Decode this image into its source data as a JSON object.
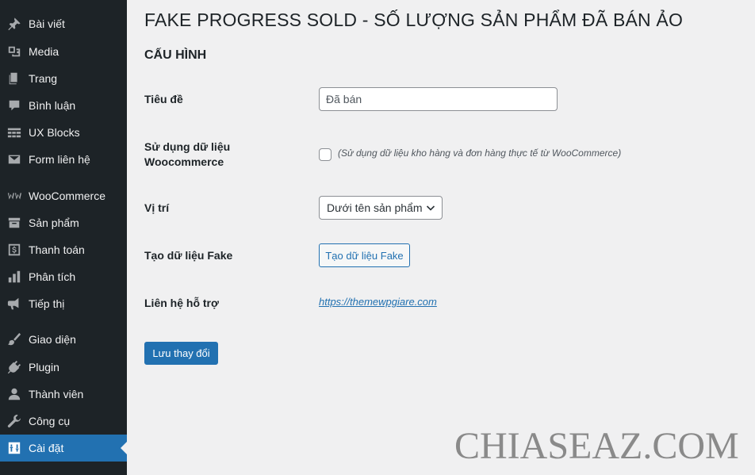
{
  "sidebar": {
    "items": [
      {
        "label": "Bài viết",
        "icon": "pin-icon"
      },
      {
        "label": "Media",
        "icon": "media-icon"
      },
      {
        "label": "Trang",
        "icon": "page-icon"
      },
      {
        "label": "Bình luận",
        "icon": "comment-icon"
      },
      {
        "label": "UX Blocks",
        "icon": "blocks-icon"
      },
      {
        "label": "Form liên hệ",
        "icon": "mail-icon"
      },
      {
        "label": "WooCommerce",
        "icon": "woocommerce-icon"
      },
      {
        "label": "Sản phẩm",
        "icon": "archive-icon"
      },
      {
        "label": "Thanh toán",
        "icon": "dollar-icon"
      },
      {
        "label": "Phân tích",
        "icon": "bar-chart-icon"
      },
      {
        "label": "Tiếp thị",
        "icon": "megaphone-icon"
      },
      {
        "label": "Giao diện",
        "icon": "brush-icon"
      },
      {
        "label": "Plugin",
        "icon": "plug-icon"
      },
      {
        "label": "Thành viên",
        "icon": "user-icon"
      },
      {
        "label": "Công cụ",
        "icon": "wrench-icon"
      },
      {
        "label": "Cài đặt",
        "icon": "settings-icon",
        "active": true
      }
    ]
  },
  "main": {
    "page_title": "FAKE PROGRESS SOLD - SỐ LƯỢNG SẢN PHẨM ĐÃ BÁN ẢO",
    "section_title": "CẤU HÌNH",
    "fields": {
      "title_label": "Tiêu đề",
      "title_value": "Đã bán",
      "woo_label_line1": "Sử dụng dữ liệu",
      "woo_label_line2": "Woocommerce",
      "woo_checked": false,
      "woo_desc": "(Sử dụng dữ liệu kho hàng và đơn hàng thực tế từ WooCommerce)",
      "position_label": "Vị trí",
      "position_value": "Dưới tên sản phẩm",
      "fake_label": "Tạo dữ liệu Fake",
      "fake_button": "Tạo dữ liệu Fake",
      "support_label": "Liên hệ hỗ trợ",
      "support_link": "https://themewpgiare.com"
    },
    "save_button": "Lưu thay đổi"
  },
  "watermark": "CHIASEAZ.COM",
  "colors": {
    "sidebar_bg": "#1d2327",
    "accent": "#2271b1",
    "page_bg": "#f0f0f1"
  }
}
